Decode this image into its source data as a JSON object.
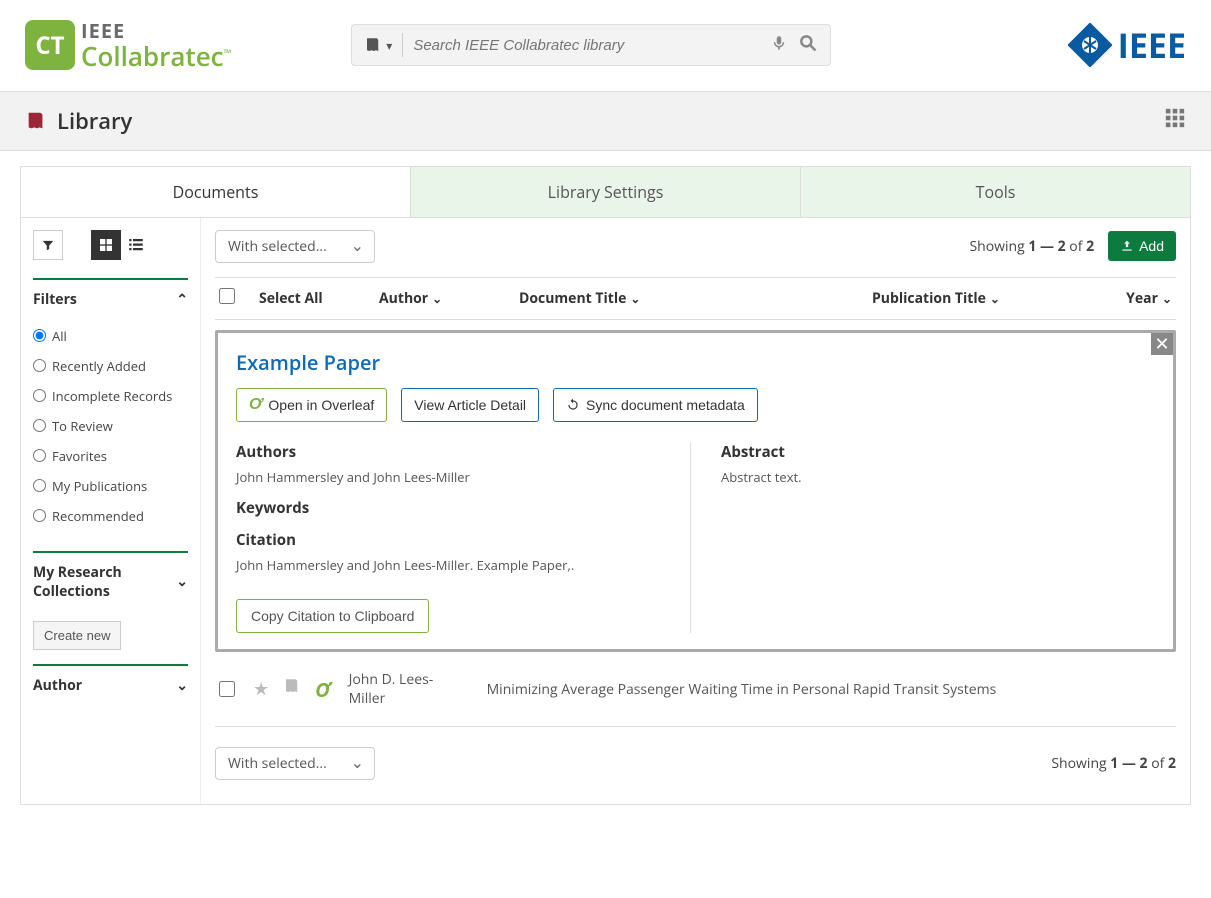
{
  "header": {
    "logo_ieee": "IEEE",
    "logo_name": "Collabratec",
    "search_placeholder": "Search IEEE Collabratec library",
    "ieee_right": "IEEE"
  },
  "section": {
    "title": "Library"
  },
  "tabs": [
    "Documents",
    "Library Settings",
    "Tools"
  ],
  "toolbar": {
    "with_selected": "With selected...",
    "showing_prefix": "Showing ",
    "range": "1 — 2",
    "showing_mid": " of ",
    "total": "2",
    "add": "Add"
  },
  "columns": {
    "select_all": "Select All",
    "author": "Author",
    "doc_title": "Document Title",
    "pub_title": "Publication Title",
    "year": "Year"
  },
  "filters": {
    "heading": "Filters",
    "options": [
      "All",
      "Recently Added",
      "Incomplete Records",
      "To Review",
      "Favorites",
      "My Publications",
      "Recommended"
    ],
    "collections_heading": "My Research Collections",
    "create_new": "Create new",
    "author_heading": "Author"
  },
  "card": {
    "title": "Example Paper",
    "open_overleaf": "Open in Overleaf",
    "view_detail": "View Article Detail",
    "sync": "Sync document metadata",
    "authors_h": "Authors",
    "authors_text": "John Hammersley and John Lees-Miller",
    "keywords_h": "Keywords",
    "citation_h": "Citation",
    "citation_text": "John Hammersley and John Lees-Miller. Example Paper,.",
    "abstract_h": "Abstract",
    "abstract_text": "Abstract text.",
    "copy": "Copy Citation to Clipboard"
  },
  "row2": {
    "author": "John D. Lees-Miller",
    "title": "Minimizing Average Passenger Waiting Time in Personal Rapid Transit Systems"
  }
}
